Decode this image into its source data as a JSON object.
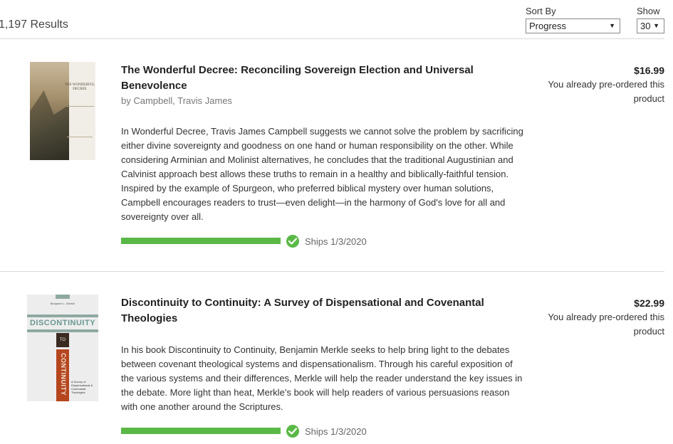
{
  "header": {
    "results_count": "1,197 Results",
    "sort_by_label": "Sort By",
    "sort_by_value": "Progress",
    "show_label": "Show",
    "show_value": "30"
  },
  "colors": {
    "progress": "#5ab946",
    "divider": "#d9d9d9"
  },
  "products": [
    {
      "title": "The Wonderful Decree: Reconciling Sovereign Election and Universal Benevolence",
      "author": "by Campbell, Travis James",
      "description": "In Wonderful Decree, Travis James Campbell suggests we cannot solve the problem by sacrificing either divine sovereignty and goodness on one hand or human responsibility on the other. While considering Arminian and Molinist alternatives, he concludes that the traditional Augustinian and Calvinist approach best allows these truths to remain in a healthy and biblically-faithful tension. Inspired by the example of Spurgeon, who preferred biblical mystery over human solutions, Campbell encourages readers to trust—even delight—in the harmony of God's love for all and sovereignty over all.",
      "price": "$16.99",
      "preorder_note": "You already pre-ordered this product",
      "ships": "Ships 1/3/2020",
      "progress": 1.0,
      "cover_title": "THE WONDERFUL DECREE",
      "icon": "check-circle-icon"
    },
    {
      "title": "Discontinuity to Continuity: A Survey of Dispensational and Covenantal Theologies",
      "author": "",
      "description": "In his book Discontinuity to Continuity, Benjamin Merkle seeks to help bring light to the debates between covenant theological systems and dispensationalism. Through his careful exposition of the various systems and their differences, Merkle will help the reader understand the key issues in the debate. More light than heat, Merkle’s book will help readers of various persuasions reason with one another around the Scriptures.",
      "price": "$22.99",
      "preorder_note": "You already pre-ordered this product",
      "ships": "Ships 1/3/2020",
      "progress": 1.0,
      "cover_author": "Benjamin L. Merkle",
      "cover_title_top": "DISCONTINUITY",
      "cover_to": "TO",
      "cover_title_bottom": "CONTINUITY",
      "cover_subtitle": "A Survey of Dispensational & Covenantal Theologies",
      "icon": "check-circle-icon"
    }
  ]
}
